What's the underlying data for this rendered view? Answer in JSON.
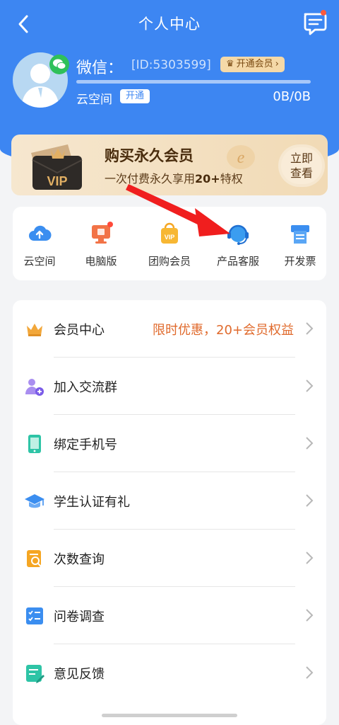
{
  "header": {
    "title": "个人中心"
  },
  "profile": {
    "name": "微信：",
    "user_id": "[ID:5303599]",
    "vip_button": "开通会员",
    "cloud_label": "云空间",
    "open_button": "开通",
    "storage_usage": "0B/0B",
    "storage_used_fraction": 0
  },
  "banner": {
    "vip_card_text": "VIP",
    "title": "购买永久会员",
    "subtitle_prefix": "一次付费永久享用",
    "subtitle_highlight": "20+",
    "subtitle_suffix": "特权",
    "button_line1": "立即",
    "button_line2": "查看"
  },
  "quick_actions": [
    {
      "label": "云空间",
      "icon": "cloud-upload-icon"
    },
    {
      "label": "电脑版",
      "icon": "desktop-icon"
    },
    {
      "label": "团购会员",
      "icon": "vip-bag-icon"
    },
    {
      "label": "产品客服",
      "icon": "headset-icon"
    },
    {
      "label": "开发票",
      "icon": "invoice-printer-icon"
    }
  ],
  "menu": [
    {
      "label": "会员中心",
      "promo": "限时优惠，20+会员权益",
      "icon": "crown-icon"
    },
    {
      "label": "加入交流群",
      "promo": "",
      "icon": "group-add-icon"
    },
    {
      "label": "绑定手机号",
      "promo": "",
      "icon": "phone-icon"
    },
    {
      "label": "学生认证有礼",
      "promo": "",
      "icon": "graduation-cap-icon"
    },
    {
      "label": "次数查询",
      "promo": "",
      "icon": "search-document-icon"
    },
    {
      "label": "问卷调查",
      "promo": "",
      "icon": "checklist-icon"
    },
    {
      "label": "意见反馈",
      "promo": "",
      "icon": "feedback-edit-icon"
    }
  ],
  "colors": {
    "brand_blue": "#3d86f2",
    "promo_orange": "#e06a2c",
    "annotation_arrow": "#f01e1e"
  }
}
